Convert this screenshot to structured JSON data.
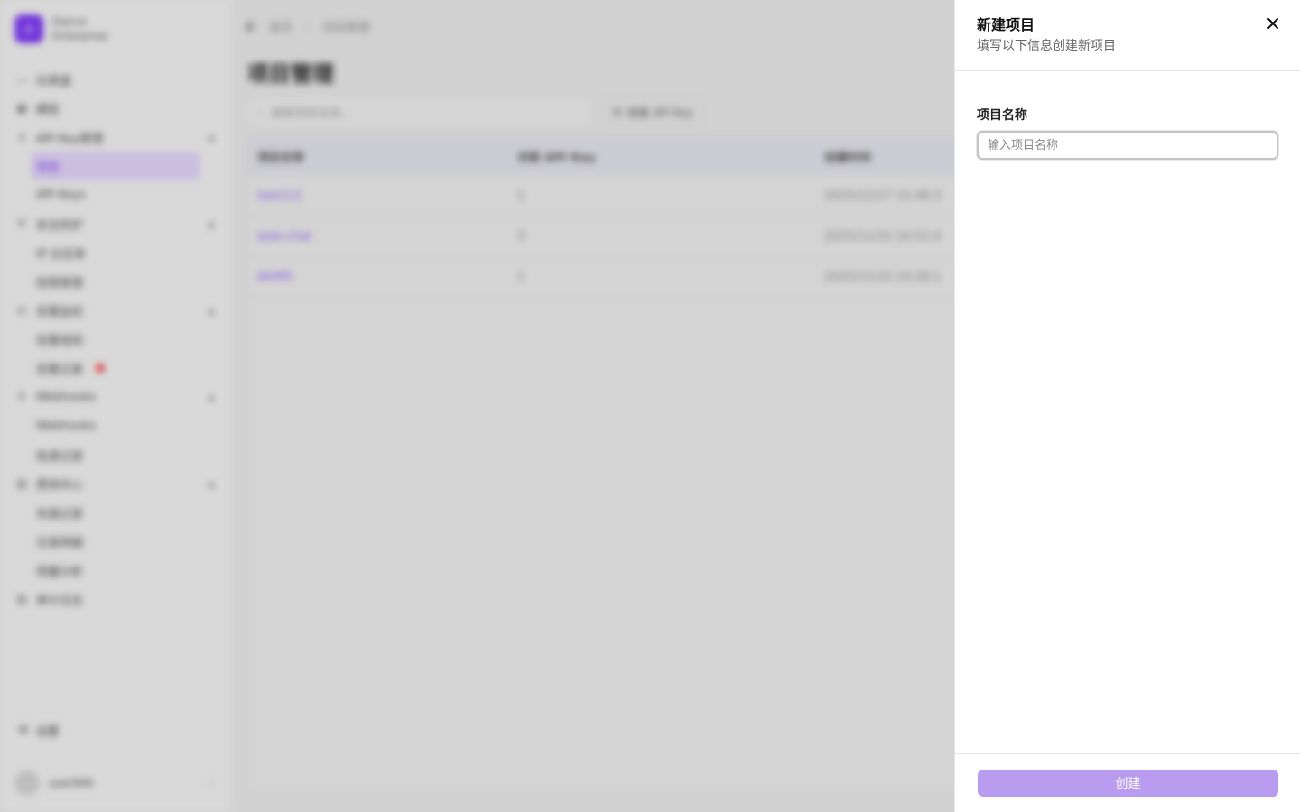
{
  "background": {
    "org": {
      "name": "Dance",
      "plan": "Enterprise"
    },
    "nav": [
      {
        "label": "仪表盘",
        "icon": "activity-icon"
      },
      {
        "label": "模型",
        "icon": "box-icon"
      },
      {
        "label": "API Key管理",
        "icon": "key-icon",
        "expanded": true
      },
      {
        "label": "项目",
        "sub": true,
        "active": true
      },
      {
        "label": "API Keys",
        "sub": true
      },
      {
        "label": "安全防护",
        "icon": "shield-icon",
        "expanded": true
      },
      {
        "label": "IP 白名单",
        "sub": true
      },
      {
        "label": "权限管理",
        "sub": true
      },
      {
        "label": "告警监控",
        "icon": "alert-icon",
        "expanded": true
      },
      {
        "label": "告警规则",
        "sub": true
      },
      {
        "label": "告警记录",
        "sub": true,
        "badge": true
      },
      {
        "label": "Webhooks",
        "icon": "webhook-icon",
        "expanded": true
      },
      {
        "label": "Webhooks",
        "sub": true
      },
      {
        "label": "投递记录",
        "sub": true
      },
      {
        "label": "费用中心",
        "icon": "wallet-icon",
        "expanded": true
      },
      {
        "label": "充值记录",
        "sub": true
      },
      {
        "label": "交易明细",
        "sub": true
      },
      {
        "label": "用量分析",
        "sub": true
      },
      {
        "label": "审计日志",
        "icon": "log-icon"
      }
    ],
    "settings_label": "设置",
    "user_name": "user999",
    "breadcrumb": {
      "home": "首页",
      "current": "项目管理"
    },
    "page_title": "项目管理",
    "search_placeholder": "搜索项目名称...",
    "filter_label": "按量 API Key",
    "table": {
      "headers": [
        "项目名称",
        "关联 API Key",
        "创建时间"
      ],
      "rows": [
        {
          "name": "test111",
          "keys": "1",
          "created": "2025/12/17 15:48:3"
        },
        {
          "name": "web-chat",
          "keys": "3",
          "created": "2025/11/24 16:52:4"
        },
        {
          "name": "AIOPS",
          "keys": "1",
          "created": "2025/11/10 19:28:1"
        }
      ]
    }
  },
  "drawer": {
    "title": "新建项目",
    "subtitle": "填写以下信息创建新项目",
    "field_label": "项目名称",
    "field_value": "",
    "field_placeholder": "输入项目名称",
    "submit_label": "创建",
    "accent_color": "#b99cf0"
  }
}
